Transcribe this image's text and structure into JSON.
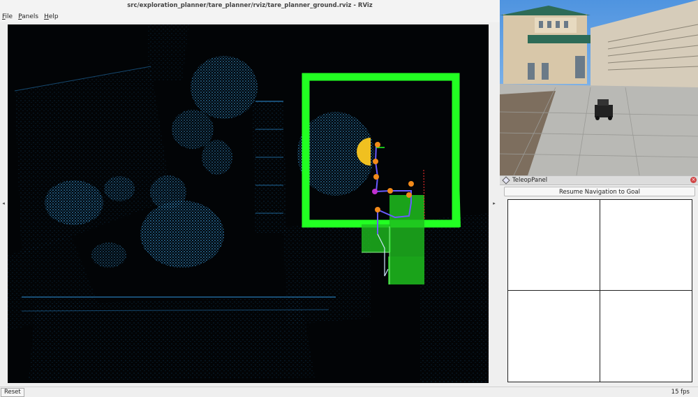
{
  "window": {
    "title": "src/exploration_planner/tare_planner/rviz/tare_planner_ground.rviz - RViz"
  },
  "menu": [
    {
      "mnemonic": "F",
      "rest": "ile"
    },
    {
      "mnemonic": "P",
      "rest": "anels"
    },
    {
      "mnemonic": "H",
      "rest": "elp"
    }
  ],
  "side_arrows": {
    "left": "◂",
    "right": "▸"
  },
  "teleop": {
    "title": "TeleopPanel",
    "close_symbol": "×",
    "resume_label": "Resume Navigation to Goal"
  },
  "status": {
    "reset_label": "Reset",
    "fps": "15 fps"
  },
  "colors": {
    "pointcloud": "#2a86c8",
    "exploration_box": "#22ff22",
    "planned_cells": "#1fbf1f",
    "waypoints": "#f28a1a",
    "path": "#6a5cff",
    "robot": "#f0c020"
  }
}
